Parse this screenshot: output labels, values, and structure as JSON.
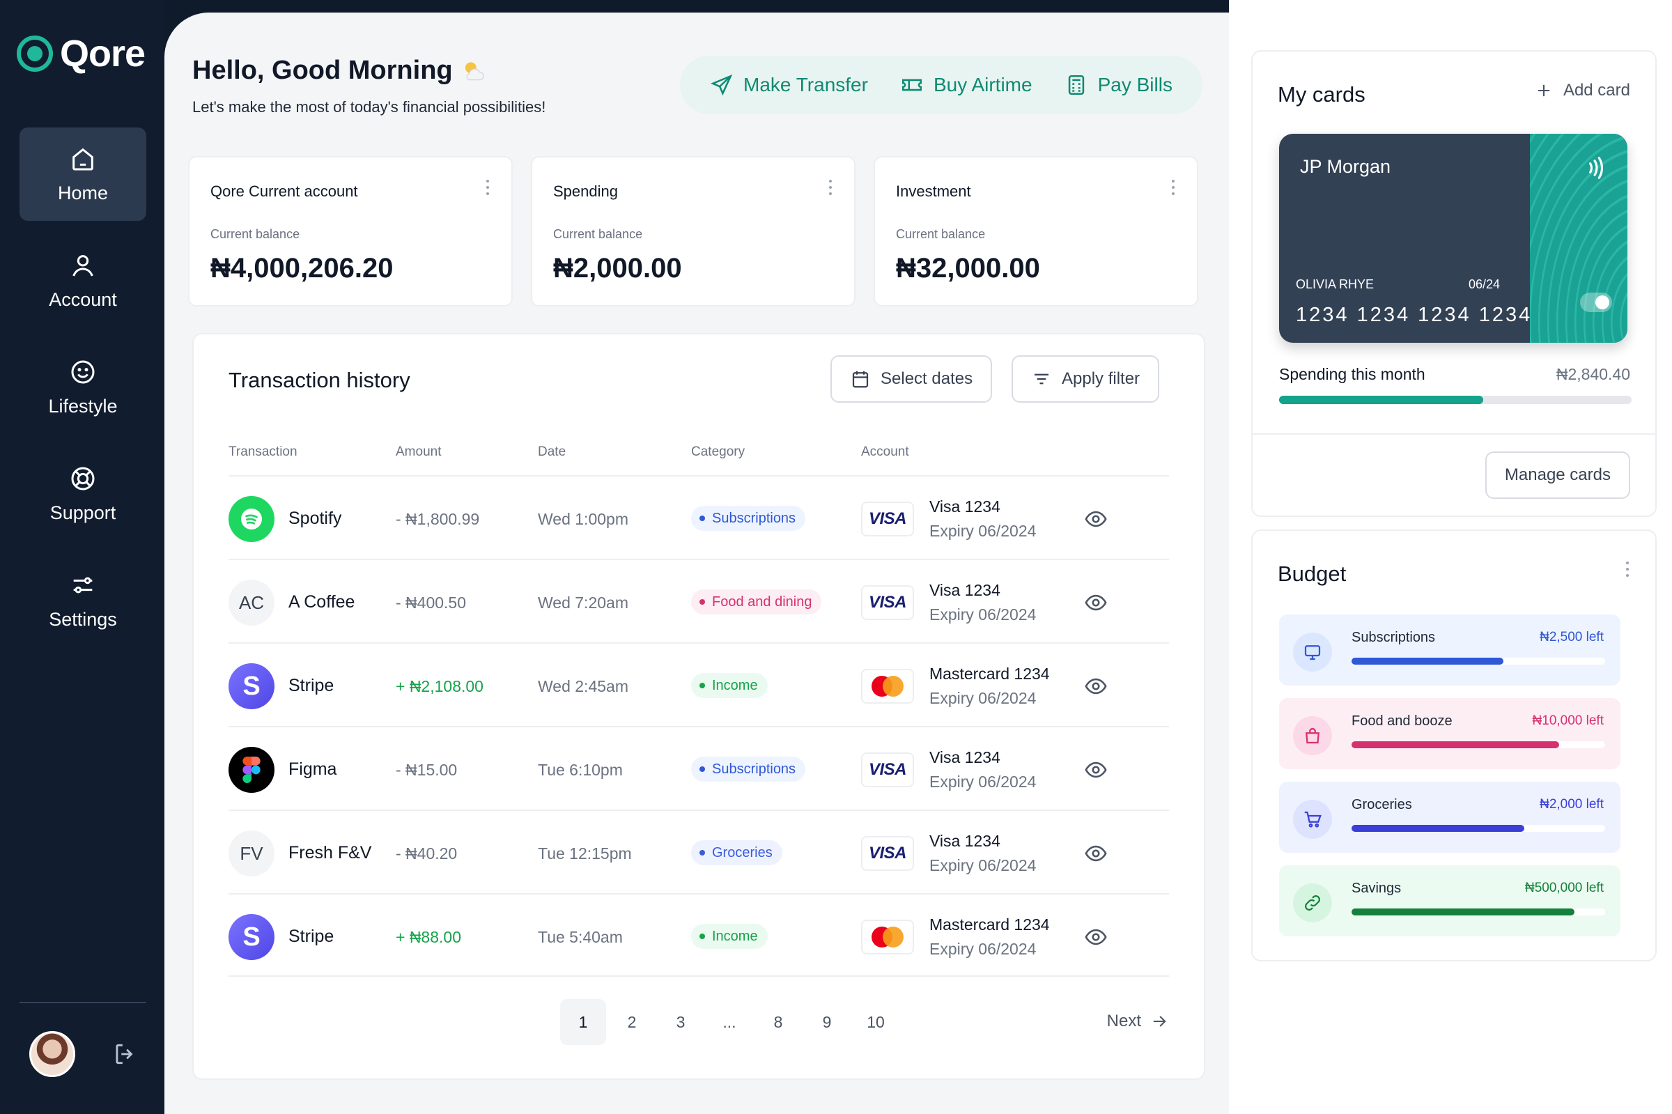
{
  "brand": {
    "name": "Qore"
  },
  "sidebar": {
    "items": [
      {
        "label": "Home",
        "icon": "home-icon",
        "active": true
      },
      {
        "label": "Account",
        "icon": "user-icon",
        "active": false
      },
      {
        "label": "Lifestyle",
        "icon": "smile-icon",
        "active": false
      },
      {
        "label": "Support",
        "icon": "lifebuoy-icon",
        "active": false
      },
      {
        "label": "Settings",
        "icon": "sliders-icon",
        "active": false
      }
    ]
  },
  "header": {
    "greeting": "Hello, Good Morning",
    "greeting_icon": "sun-cloud-icon",
    "subtitle": "Let's make the most of today's financial possibilities!",
    "actions": {
      "transfer": "Make Transfer",
      "airtime": "Buy Airtime",
      "bills": "Pay Bills"
    }
  },
  "accounts": [
    {
      "title": "Qore Current account",
      "sub": "Current balance",
      "balance": "₦4,000,206.20"
    },
    {
      "title": "Spending",
      "sub": "Current balance",
      "balance": "₦2,000.00"
    },
    {
      "title": "Investment",
      "sub": "Current balance",
      "balance": "₦32,000.00"
    }
  ],
  "transactions": {
    "title": "Transaction history",
    "select_dates": "Select dates",
    "apply_filter": "Apply filter",
    "columns": {
      "transaction": "Transaction",
      "amount": "Amount",
      "date": "Date",
      "category": "Category",
      "account": "Account"
    },
    "rows": [
      {
        "name": "Spotify",
        "logo": "",
        "amount": "- ₦1,800.99",
        "date": "Wed 1:00pm",
        "category": "Subscriptions",
        "card": "Visa 1234",
        "expiry": "Expiry 06/2024"
      },
      {
        "name": "A Coffee",
        "logo": "AC",
        "amount": "- ₦400.50",
        "date": "Wed 7:20am",
        "category": "Food and dining",
        "card": "Visa 1234",
        "expiry": "Expiry 06/2024"
      },
      {
        "name": "Stripe",
        "logo": "S",
        "amount": "+ ₦2,108.00",
        "date": "Wed 2:45am",
        "category": "Income",
        "card": "Mastercard 1234",
        "expiry": "Expiry 06/2024"
      },
      {
        "name": "Figma",
        "logo": "",
        "amount": "- ₦15.00",
        "date": "Tue 6:10pm",
        "category": "Subscriptions",
        "card": "Visa 1234",
        "expiry": "Expiry 06/2024"
      },
      {
        "name": "Fresh F&V",
        "logo": "FV",
        "amount": "- ₦40.20",
        "date": "Tue 12:15pm",
        "category": "Groceries",
        "card": "Visa 1234",
        "expiry": "Expiry 06/2024"
      },
      {
        "name": "Stripe",
        "logo": "S",
        "amount": "+ ₦88.00",
        "date": "Tue 5:40am",
        "category": "Income",
        "card": "Mastercard 1234",
        "expiry": "Expiry 06/2024"
      }
    ],
    "visa_text": "VISA",
    "pagination": {
      "pages": [
        "1",
        "2",
        "3",
        "...",
        "8",
        "9",
        "10"
      ],
      "active": "1",
      "next": "Next"
    }
  },
  "my_cards": {
    "title": "My cards",
    "add_card": "Add card",
    "card": {
      "bank": "JP Morgan",
      "holder": "OLIVIA RHYE",
      "expiry": "06/24",
      "number": "1234 1234 1234 1234"
    },
    "spending_label": "Spending this month",
    "spending_value": "₦2,840.40",
    "spending_progress": 0.58,
    "manage": "Manage cards"
  },
  "budget": {
    "title": "Budget",
    "items": [
      {
        "name": "Subscriptions",
        "left": "₦2,500 left",
        "progress": 0.6,
        "color": "#2f57d6",
        "bg": "#eef4ff",
        "icon": "monitor-icon"
      },
      {
        "name": "Food and booze",
        "left": "₦10,000 left",
        "progress": 0.82,
        "color": "#d6316f",
        "bg": "#fdeef4",
        "icon": "bag-icon"
      },
      {
        "name": "Groceries",
        "left": "₦2,000 left",
        "progress": 0.68,
        "color": "#3b3fd8",
        "bg": "#eef2ff",
        "icon": "cart-icon"
      },
      {
        "name": "Savings",
        "left": "₦500,000 left",
        "progress": 0.88,
        "color": "#15803d",
        "bg": "#ecfbf1",
        "icon": "link-icon"
      }
    ]
  },
  "colors": {
    "accent": "#0f8a72",
    "sidebar": "#111c2e",
    "positive": "#16a34a"
  }
}
